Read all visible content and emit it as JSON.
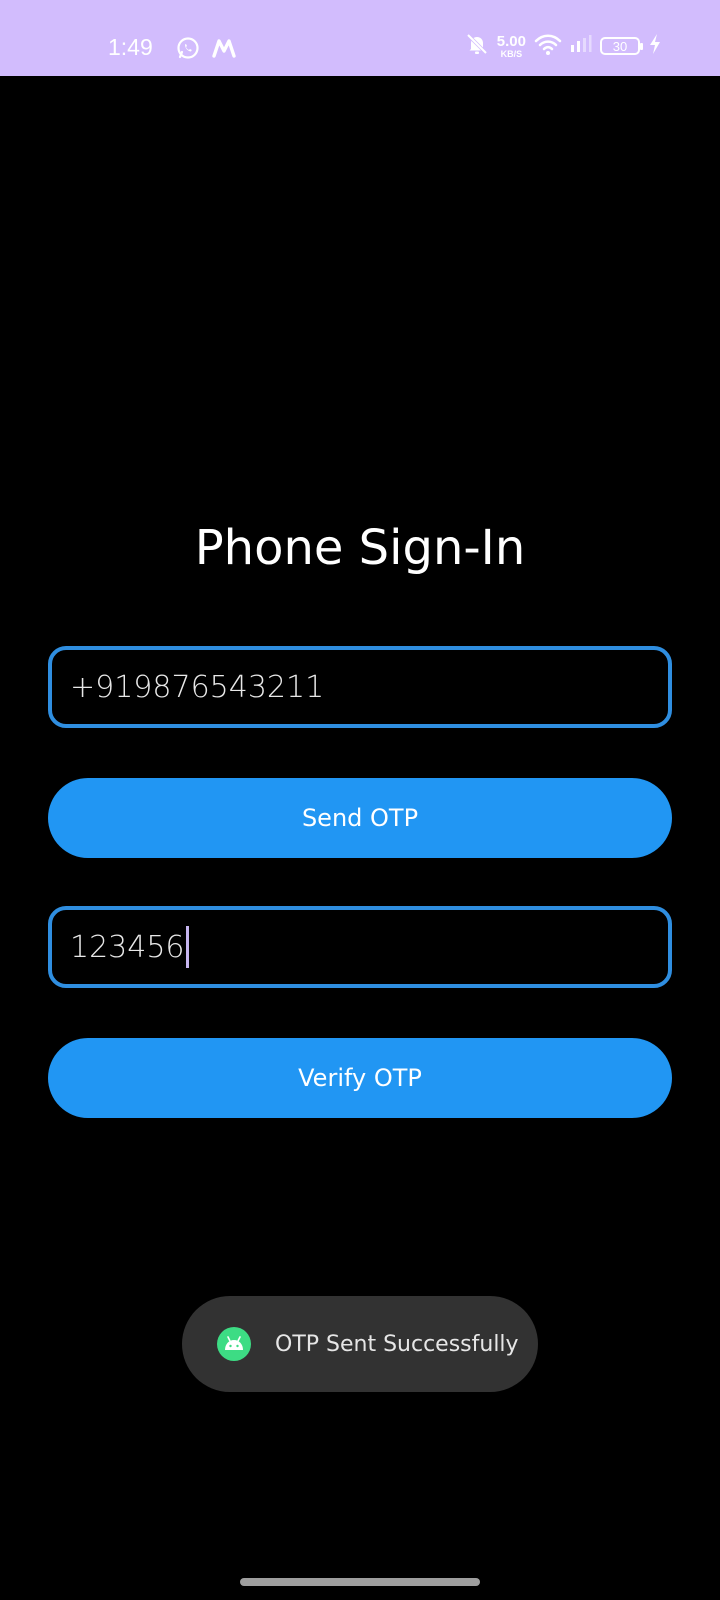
{
  "status_bar": {
    "time": "1:49",
    "left_icons": [
      "whatsapp-icon",
      "m-app-icon"
    ],
    "network_speed": "5.00",
    "network_speed_unit": "KB/S",
    "right_icons": [
      "mute-icon",
      "wifi-icon",
      "signal-icon",
      "battery-icon",
      "charging-icon"
    ],
    "battery_level": "30",
    "background_color": "#d2bcfd"
  },
  "main": {
    "title": "Phone Sign-In",
    "phone_input": {
      "value": "+919876543211"
    },
    "send_otp_label": "Send OTP",
    "otp_input": {
      "value": "123456"
    },
    "verify_otp_label": "Verify OTP",
    "accent_color": "#2196f3",
    "field_border_color": "#2f8ee0"
  },
  "toast": {
    "icon": "android-icon",
    "message": "OTP Sent Successfully"
  },
  "nav": {
    "handle": "gesture-navigation-handle"
  }
}
